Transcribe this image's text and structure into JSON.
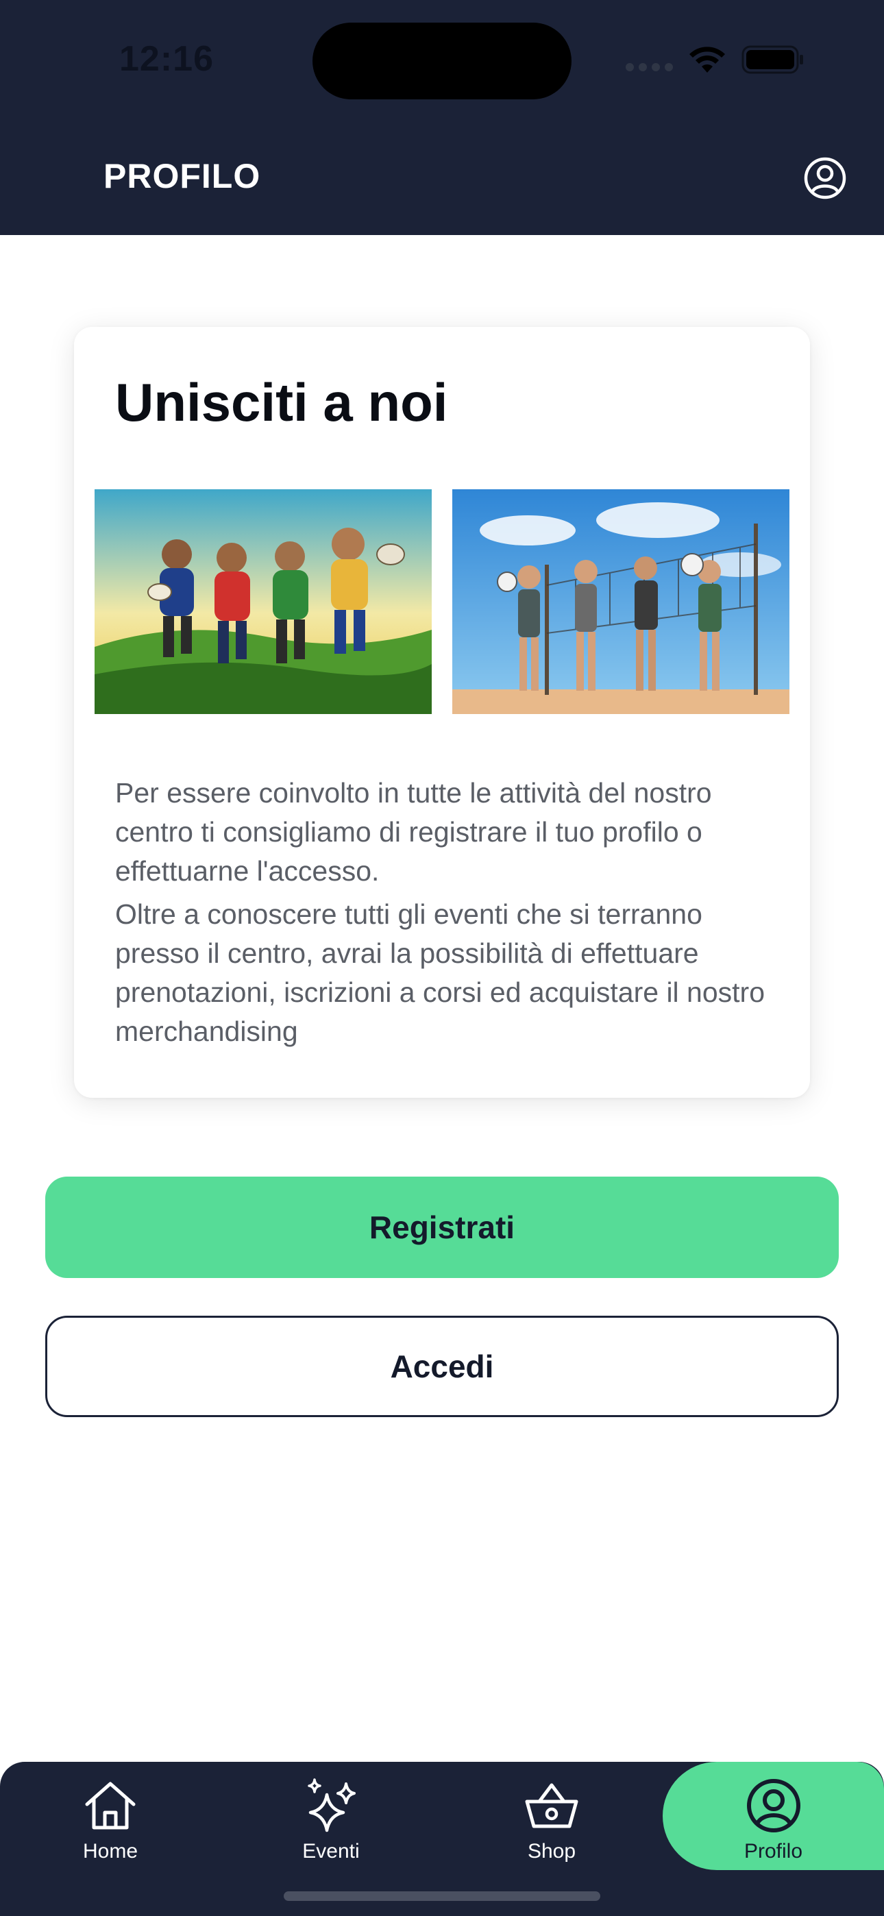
{
  "status_bar": {
    "time": "12:16"
  },
  "header": {
    "title": "PROFILO",
    "account_icon": "account-circle-icon"
  },
  "card": {
    "title": "Unisciti a noi",
    "images": [
      {
        "name": "rugby-players-illustration"
      },
      {
        "name": "volleyball-players-illustration"
      }
    ],
    "paragraphs": [
      "Per essere coinvolto in tutte le attività del nostro centro ti consigliamo di registrare il tuo profilo o effettuarne l'accesso.",
      "Oltre a conoscere tutti gli eventi che si terranno presso il centro, avrai la possibilità di effettuare prenotazioni, iscrizioni a corsi ed acquistare il nostro merchandising"
    ]
  },
  "buttons": {
    "register_label": "Registrati",
    "login_label": "Accedi"
  },
  "tabbar": {
    "items": [
      {
        "label": "Home",
        "icon": "home-icon"
      },
      {
        "label": "Eventi",
        "icon": "sparkles-icon"
      },
      {
        "label": "Shop",
        "icon": "basket-icon"
      },
      {
        "label": "Profilo",
        "icon": "account-circle-icon",
        "active": true
      }
    ]
  },
  "colors": {
    "header_bg": "#1b2237",
    "accent": "#56dc97",
    "text_dark": "#141a2b",
    "text_muted": "#5a5e66"
  }
}
